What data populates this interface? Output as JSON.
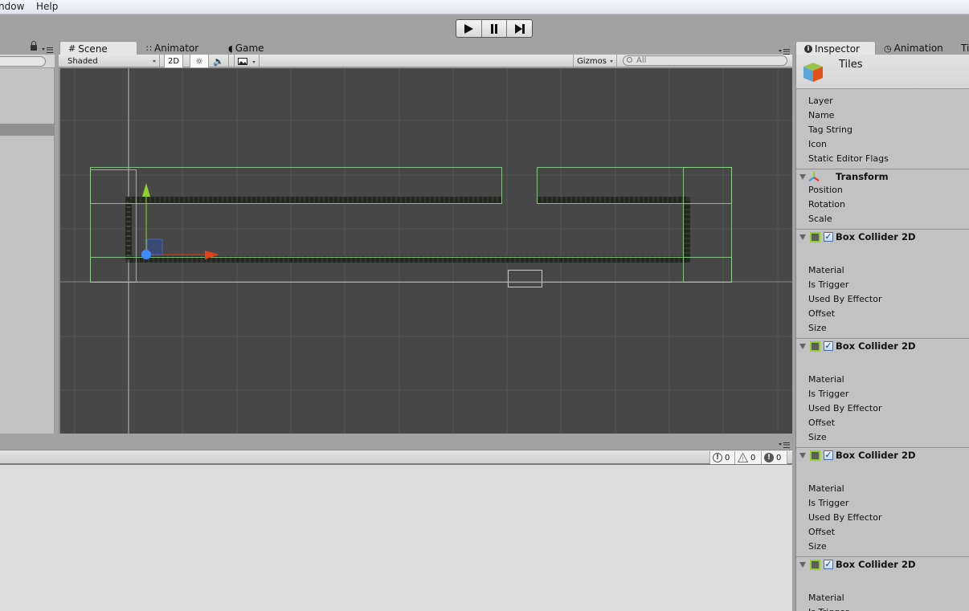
{
  "menubar": {
    "items": [
      "ndow",
      "Help"
    ]
  },
  "playbar": {
    "buttons": [
      "play",
      "pause",
      "step"
    ]
  },
  "scene_tabs": [
    {
      "label": "Scene",
      "icon": "grid-icon",
      "active": true
    },
    {
      "label": "Animator",
      "icon": "animator-icon",
      "active": false
    },
    {
      "label": "Game",
      "icon": "pacman-icon",
      "active": false
    }
  ],
  "scene_toolbar": {
    "shading_mode": "Shaded",
    "mode_2d": "2D",
    "gizmos_label": "Gizmos",
    "search_placeholder": "All"
  },
  "console": {
    "info_count": "0",
    "warning_count": "0",
    "error_count": "0"
  },
  "inspector": {
    "tabs": [
      {
        "label": "Inspector",
        "icon": "info-icon",
        "active": true
      },
      {
        "label": "Animation",
        "icon": "clock-icon",
        "active": false
      },
      {
        "label": "Ti",
        "icon": "",
        "active": false
      }
    ],
    "object_name": "Tiles",
    "object_fields": [
      "Layer",
      "Name",
      "Tag String",
      "Icon",
      "Static Editor Flags"
    ],
    "components": [
      {
        "title": "Transform",
        "fields": [
          "Position",
          "Rotation",
          "Scale"
        ]
      },
      {
        "title": "Box Collider 2D",
        "enabled": true,
        "fields": [
          "Material",
          "Is Trigger",
          "Used By Effector",
          "Offset",
          "Size"
        ]
      },
      {
        "title": "Box Collider 2D",
        "enabled": true,
        "fields": [
          "Material",
          "Is Trigger",
          "Used By Effector",
          "Offset",
          "Size"
        ]
      },
      {
        "title": "Box Collider 2D",
        "enabled": true,
        "fields": [
          "Material",
          "Is Trigger",
          "Used By Effector",
          "Offset",
          "Size"
        ]
      },
      {
        "title": "Box Collider 2D",
        "enabled": true,
        "fields": [
          "Material",
          "Is Trigger"
        ]
      }
    ]
  },
  "colors": {
    "collider_green": "#8fd88a",
    "viewport_bg": "#474747",
    "gizmo_y": "#8ed12b",
    "gizmo_x": "#e0401a",
    "gizmo_center": "#3d8bff"
  }
}
